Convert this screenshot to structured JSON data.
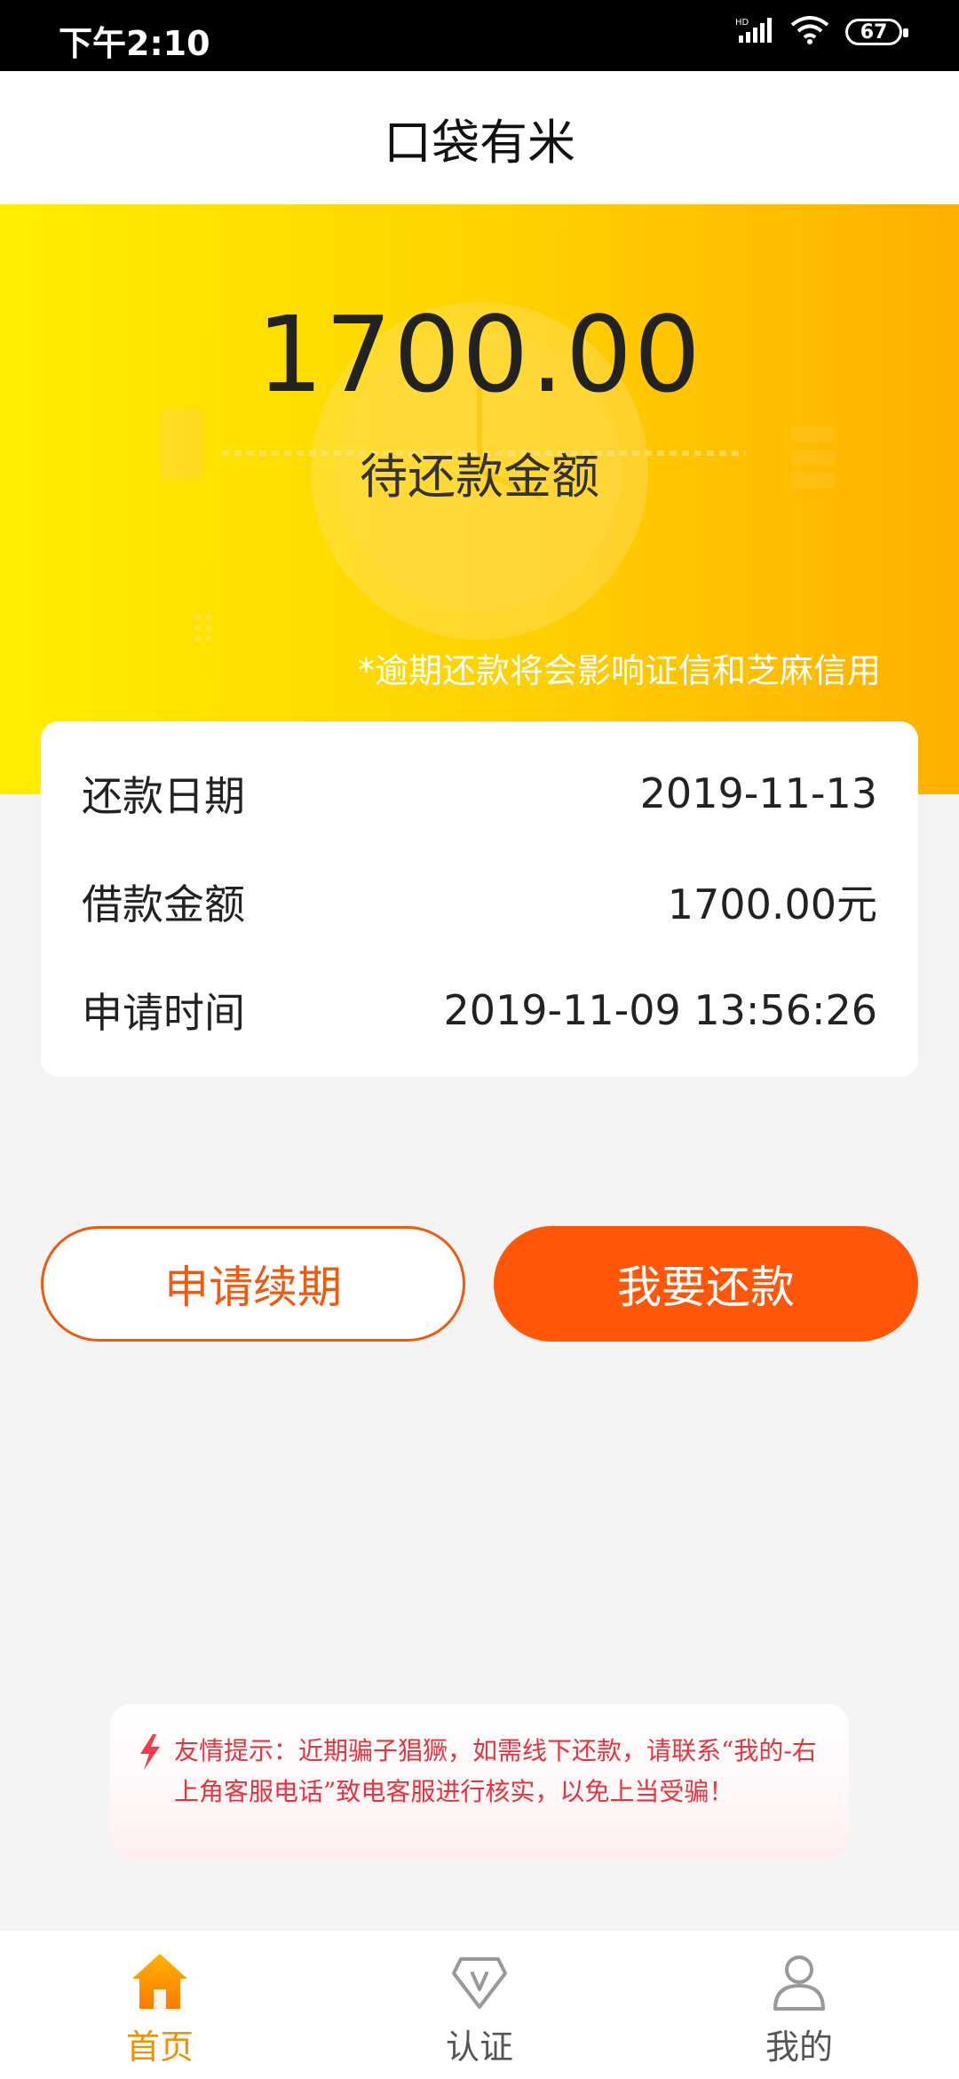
{
  "status_bar": {
    "time": "下午2:10",
    "network": "HD",
    "battery": "67"
  },
  "header": {
    "title": "口袋有米"
  },
  "hero": {
    "amount": "1700.00",
    "label": "待还款金额",
    "note": "*逾期还款将会影响证信和芝麻信用"
  },
  "details": [
    {
      "label": "还款日期",
      "value": "2019-11-13"
    },
    {
      "label": "借款金额",
      "value": "1700.00元"
    },
    {
      "label": "申请时间",
      "value": "2019-11-09 13:56:26"
    }
  ],
  "buttons": {
    "renew": "申请续期",
    "repay": "我要还款"
  },
  "tip": {
    "text": "友情提示：近期骗子猖獗，如需线下还款，请联系“我的-右上角客服电话”致电客服进行核实，以免上当受骗！"
  },
  "nav": {
    "items": [
      {
        "label": "首页",
        "icon": "home-icon",
        "active": true
      },
      {
        "label": "认证",
        "icon": "verify-icon",
        "active": false
      },
      {
        "label": "我的",
        "icon": "user-icon",
        "active": false
      }
    ]
  },
  "colors": {
    "accent": "#ff560a",
    "nav_active": "#f39000",
    "tip_text": "#e8333f"
  }
}
